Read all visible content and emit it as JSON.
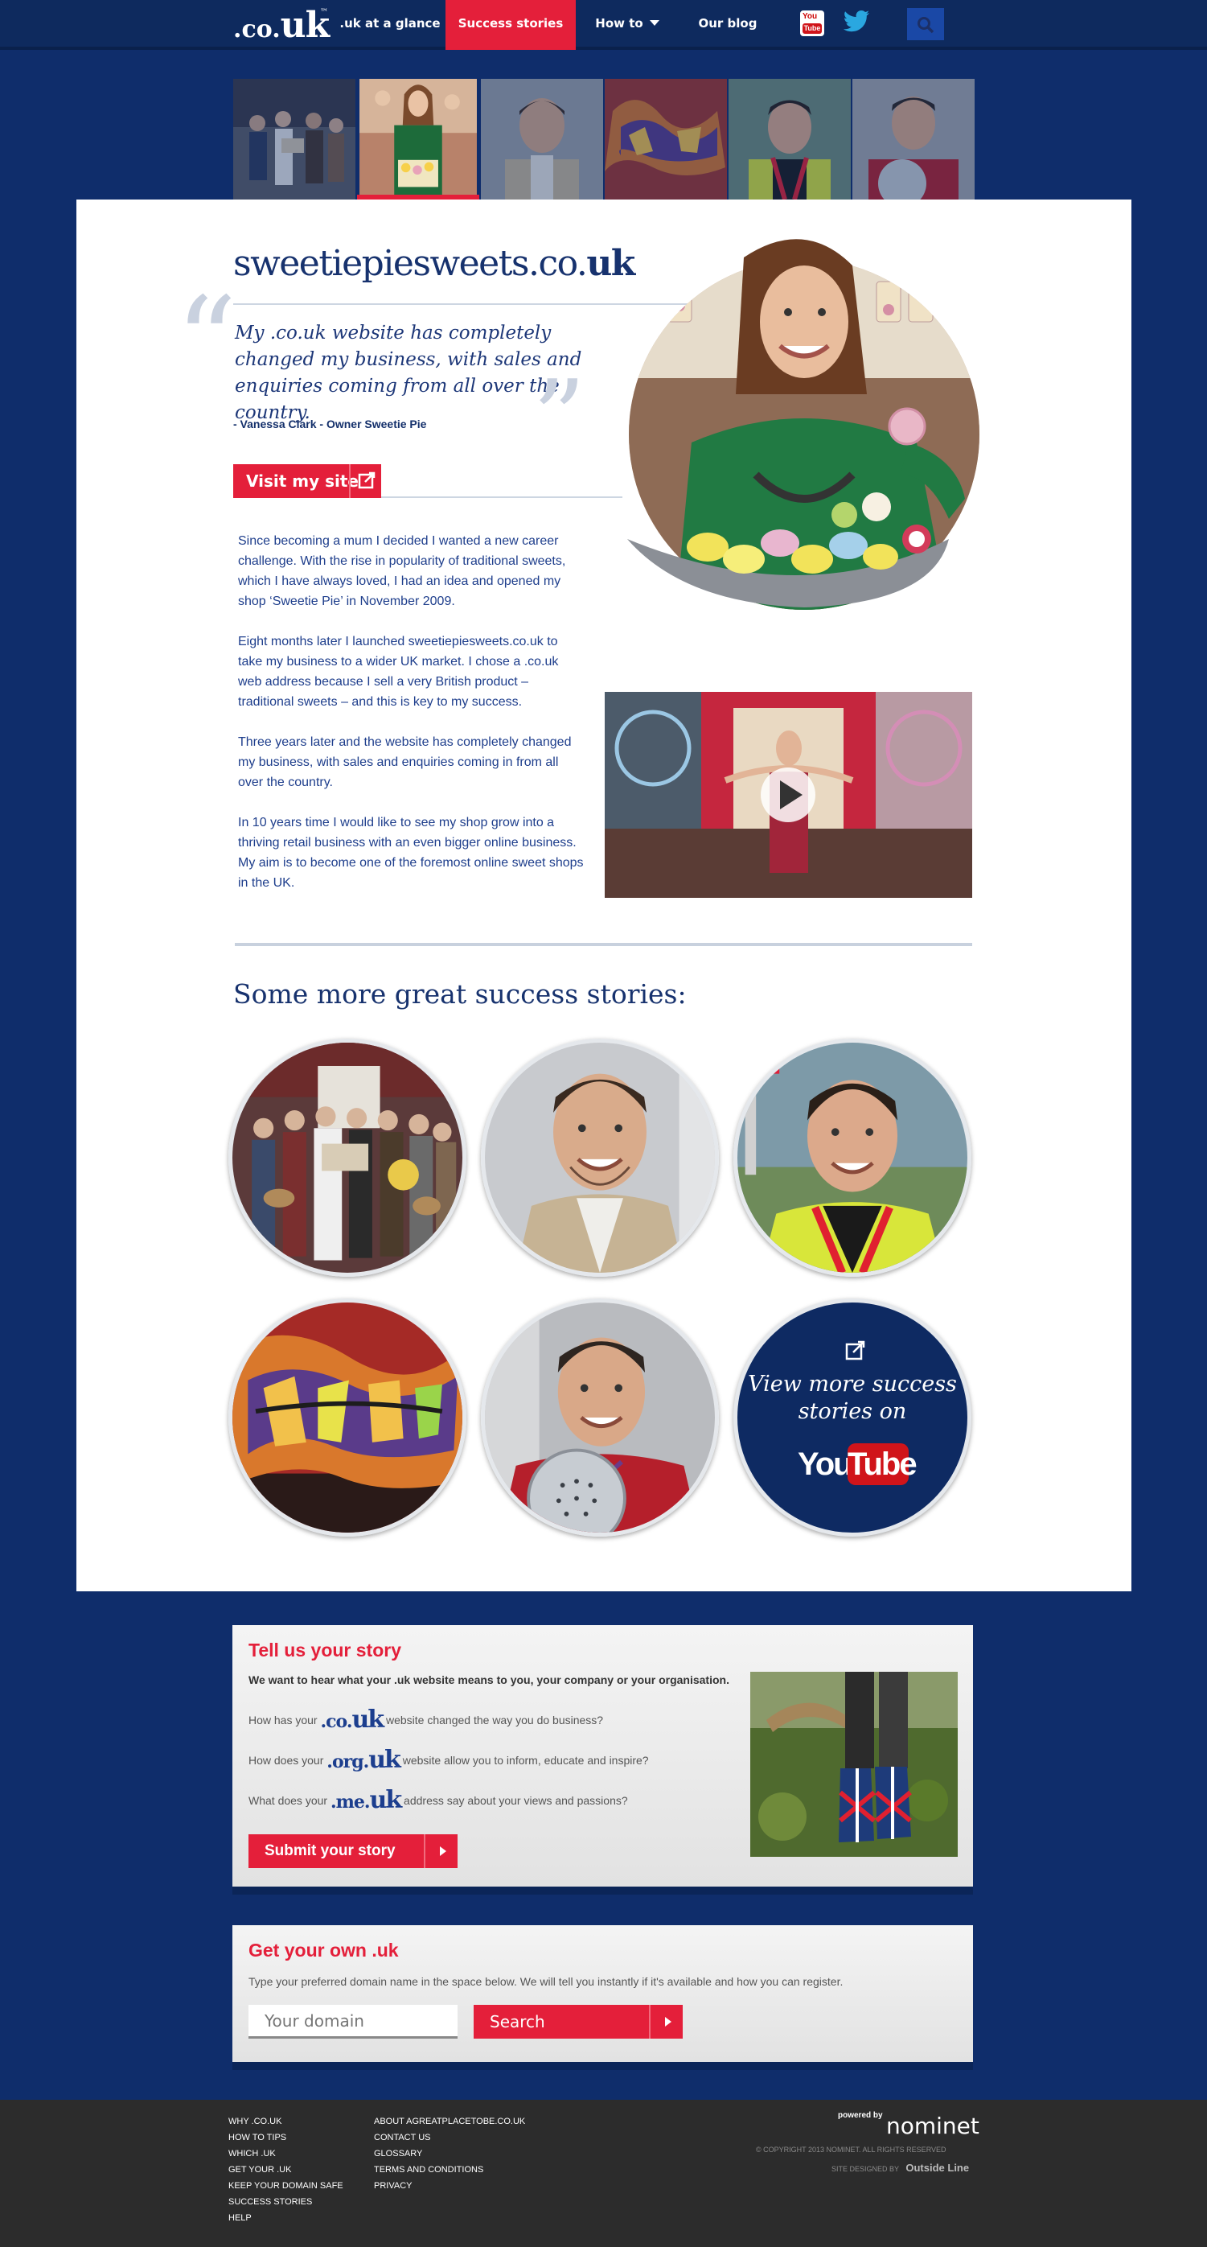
{
  "nav": {
    "logo_prefix": ".co.",
    "logo_main": "uk",
    "logo_tm": "™",
    "items": [
      ".uk at a glance",
      "Success stories",
      "How to",
      "Our blog"
    ],
    "youtube_top": "You",
    "youtube_bottom": "Tube"
  },
  "story": {
    "site_prefix": "sweetiepiesweets.co.",
    "site_suffix": "uk",
    "quote": "My .co.uk website has completely changed my business, with sales and enquiries coming from all over the country.",
    "byline": "- Vanessa Clark - Owner Sweetie Pie",
    "visit_label": "Visit my site",
    "paragraphs": [
      "Since becoming a mum I decided I wanted a new career challenge. With the rise in popularity of traditional sweets, which I have always loved, I had an idea and opened my shop ‘Sweetie Pie’ in November 2009.",
      "Eight months later I launched sweetiepiesweets.co.uk to take my business to a wider UK market.  I chose a .co.uk web address because I sell a very British product – traditional sweets – and this is key to my success.",
      "Three years later and the website has completely changed my business, with sales and enquiries coming in from all over the country.",
      "In 10 years time I would like to see my shop grow into a thriving retail business with an even bigger online business. My aim is to become one of the foremost online sweet shops in the UK."
    ]
  },
  "more": {
    "title": "Some more great success stories:",
    "yt_text": "View more success stories on",
    "yt_you": "You",
    "yt_tube": "Tube"
  },
  "tell": {
    "title": "Tell us your story",
    "intro": "We want to hear what your .uk website means to you, your company or your organisation.",
    "q1_before": "How has your",
    "q1_domain_a": ".co.",
    "q1_domain_b": "uk",
    "q1_after": "website changed the way you do business?",
    "q2_before": "How does your",
    "q2_domain_a": ".org.",
    "q2_domain_b": "uk",
    "q2_after": "website allow you to inform, educate and inspire?",
    "q3_before": "What does your",
    "q3_domain_a": ".me.",
    "q3_domain_b": "uk",
    "q3_after": "address say about your views and passions?",
    "submit_label": "Submit your story"
  },
  "get": {
    "title": "Get your own .uk",
    "text": "Type your preferred domain name in the space below. We will tell you instantly if it's available and how you can register.",
    "placeholder": "Your domain",
    "search_label": "Search"
  },
  "footer": {
    "col1": [
      "WHY .CO.UK",
      "HOW TO TIPS",
      "WHICH .UK",
      "GET YOUR .UK",
      "KEEP YOUR DOMAIN SAFE",
      "SUCCESS STORIES",
      "HELP"
    ],
    "col2": [
      "ABOUT AGREATPLACETOBE.CO.UK",
      "CONTACT US",
      "GLOSSARY",
      "TERMS AND CONDITIONS",
      "PRIVACY"
    ],
    "powered_by": "powered by",
    "brand": "nominet",
    "copyright": "© COPYRIGHT 2013 NOMINET. ALL RIGHTS RESERVED",
    "designed_by": "SITE DESIGNED BY",
    "designer": "Outside Line"
  },
  "colors": {
    "navy": "#0f2d6b",
    "accent": "#e41f3a",
    "panel": "#ffffff"
  }
}
